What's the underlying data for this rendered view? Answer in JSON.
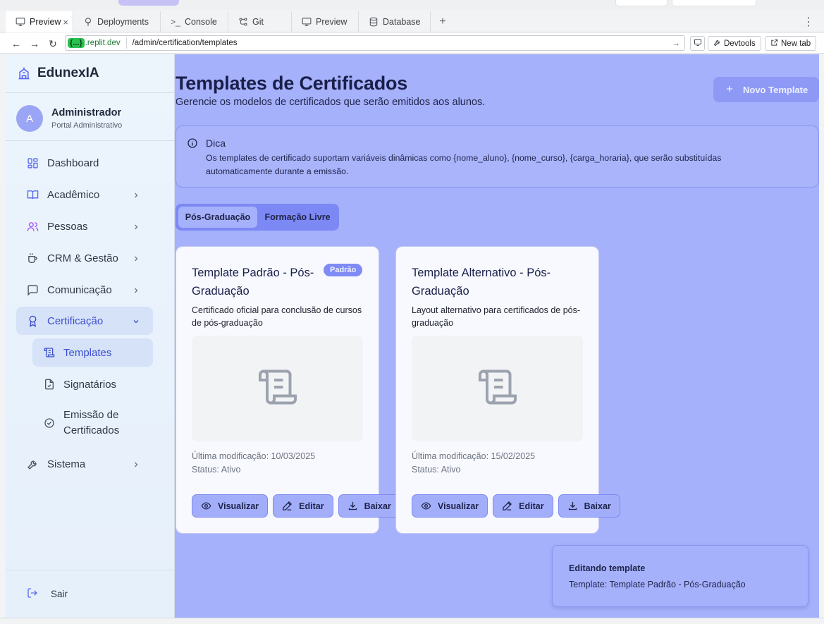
{
  "browser": {
    "tabs": [
      {
        "label": "Preview",
        "icon": "monitor-icon",
        "active": true
      },
      {
        "label": "Deployments",
        "icon": "deploy-icon"
      },
      {
        "label": "Console",
        "icon": "terminal-icon"
      },
      {
        "label": "Git",
        "icon": "git-icon"
      },
      {
        "label": "Preview",
        "icon": "monitor-icon"
      },
      {
        "label": "Database",
        "icon": "database-icon"
      }
    ],
    "url_badge": "{...}",
    "url_host": ".replit.dev",
    "url_path": "/admin/certification/templates",
    "devtools_label": "Devtools",
    "newtab_label": "New tab"
  },
  "sidebar": {
    "brand": "EdunexIA",
    "user": {
      "initial": "A",
      "name": "Administrador",
      "role": "Portal Administrativo"
    },
    "items": [
      {
        "label": "Dashboard",
        "icon": "grid-icon"
      },
      {
        "label": "Acadêmico",
        "icon": "book-open-icon"
      },
      {
        "label": "Pessoas",
        "icon": "users-icon"
      },
      {
        "label": "CRM & Gestão",
        "icon": "coffee-cup-icon"
      },
      {
        "label": "Comunicação",
        "icon": "message-square-icon"
      },
      {
        "label": "Certificação",
        "icon": "award-icon"
      },
      {
        "label": "Sistema",
        "icon": "wrench-icon"
      }
    ],
    "subitems": [
      {
        "label": "Templates",
        "icon": "scroll-icon"
      },
      {
        "label": "Signatários",
        "icon": "file-check-icon"
      },
      {
        "label": "Emissão de Certificados",
        "icon": "check-circle-icon"
      }
    ],
    "logout": "Sair"
  },
  "page": {
    "title": "Templates de Certificados",
    "subtitle": "Gerencie os modelos de certificados que serão emitidos aos alunos.",
    "new_button": "Novo Template",
    "tip_title": "Dica",
    "tip_text": "Os templates de certificado suportam variáveis dinâmicas como {nome_aluno}, {nome_curso}, {carga_horaria}, que serão substituídas automaticamente durante a emissão.",
    "tabs": [
      "Pós-Graduação",
      "Formação Livre"
    ],
    "cards": [
      {
        "title": "Template Padrão - Pós-Graduação",
        "badge": "Padrão",
        "description": "Certificado oficial para conclusão de cursos de pós-graduação",
        "modified": "Última modificação: 10/03/2025",
        "status": "Status: Ativo"
      },
      {
        "title": "Template Alternativo - Pós-Graduação",
        "description": "Layout alternativo para certificados de pós-graduação",
        "modified": "Última modificação: 15/02/2025",
        "status": "Status: Ativo"
      }
    ],
    "actions": {
      "view": "Visualizar",
      "edit": "Editar",
      "download": "Baixar"
    },
    "toast": {
      "title": "Editando template",
      "body": "Template: Template Padrão - Pós-Graduação"
    }
  },
  "colors": {
    "accent": "#8e99f6",
    "main_bg": "#a6b1fb",
    "active_nav": "#3d50cf"
  }
}
